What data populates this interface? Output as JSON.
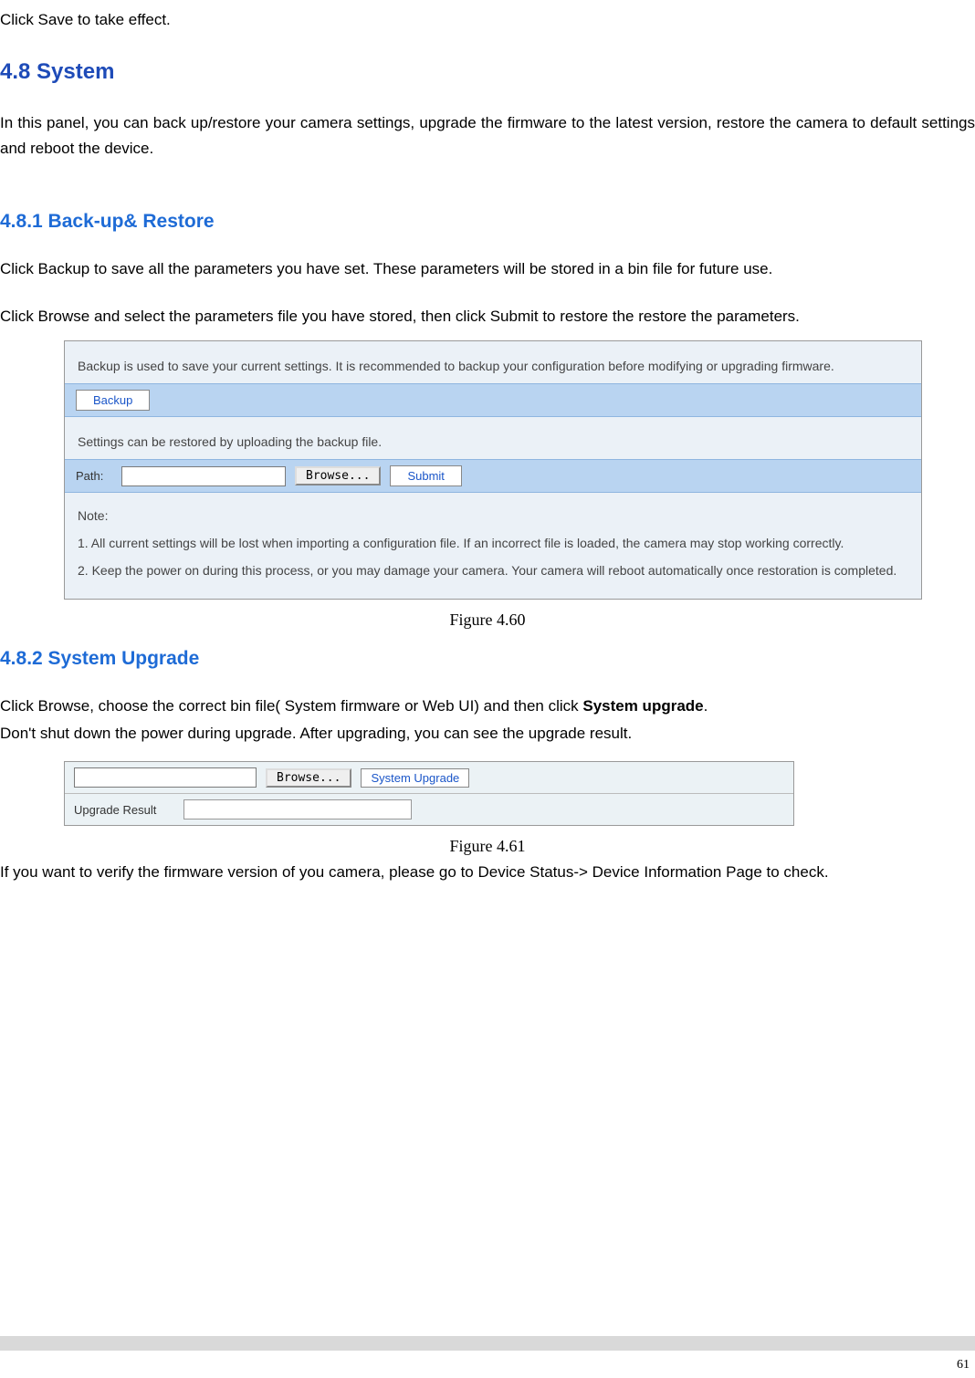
{
  "intro_line": "Click Save to take effect.",
  "heading_48": "4.8 System",
  "p48": "In this panel, you can back up/restore your camera settings, upgrade the firmware to the latest version, restore the camera to default settings and reboot the device.",
  "heading_481": "4.8.1 Back-up& Restore",
  "p481a": "Click Backup to save all the parameters you have set. These parameters will be stored in a bin file for future use.",
  "p481b": "Click Browse and select the parameters file you have stored, then click Submit to restore the restore the parameters.",
  "panel1": {
    "desc_backup": "Backup is used to save your current settings. It is recommended to backup your configuration before modifying or upgrading firmware.",
    "backup_btn": "Backup",
    "desc_restore": "Settings can be restored by uploading the backup file.",
    "path_label": "Path:",
    "path_value": "",
    "browse_btn": "Browse...",
    "submit_btn": "Submit",
    "note_title": "Note:",
    "note1": "1. All current settings will be lost when importing a configuration file. If an incorrect file is loaded, the camera may stop working correctly.",
    "note2": "2. Keep the power on during this process, or you may damage your camera. Your camera will reboot automatically once restoration is completed."
  },
  "figure460": "Figure 4.60",
  "heading_482": "4.8.2 System Upgrade",
  "p482a_pre": "Click Browse, choose the correct bin file( System firmware or Web UI) and then click ",
  "p482a_bold": "System upgrade",
  "p482a_post": ".",
  "p482b": "Don't shut down the power during upgrade. After upgrading, you can see the upgrade result.",
  "panel2": {
    "path_value": "",
    "browse_btn": "Browse...",
    "sysupgrade_btn": "System Upgrade",
    "result_label": "Upgrade Result",
    "result_value": ""
  },
  "figure461": "Figure 4.61",
  "p_after461": "If you want to verify the firmware version of you camera, please go to Device Status-> Device Information Page to check.",
  "page_number": "61"
}
